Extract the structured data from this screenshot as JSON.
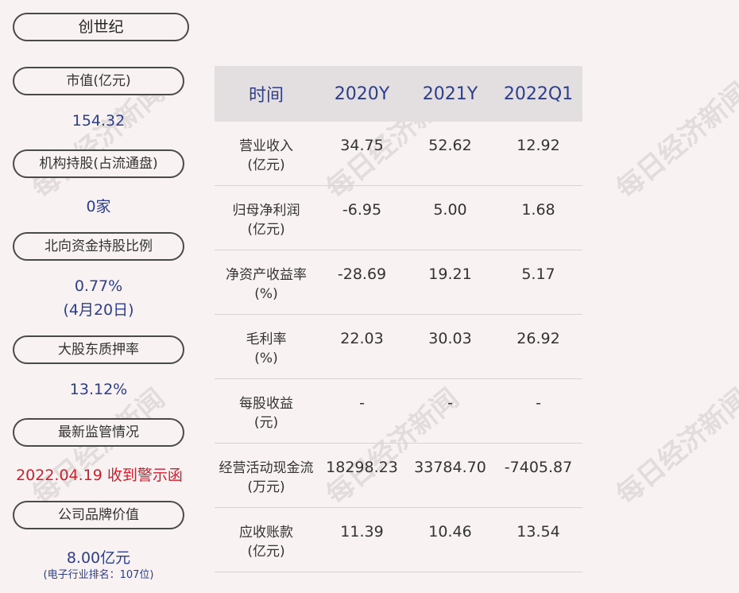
{
  "company": "创世纪",
  "metrics": [
    {
      "label": "市值(亿元)",
      "value": "154.32"
    },
    {
      "label": "机构持股(占流通盘)",
      "value": "0家"
    },
    {
      "label": "北向资金持股比例",
      "value": "0.77%",
      "value2": "(4月20日)"
    },
    {
      "label": "大股东质押率",
      "value": "13.12%"
    },
    {
      "label": "最新监管情况",
      "value": "2022.04.19 收到警示函"
    },
    {
      "label": "公司品牌价值",
      "value": "8.00亿元",
      "note": "(电子行业排名：107位)"
    }
  ],
  "table": {
    "headers": [
      "时间",
      "2020Y",
      "2021Y",
      "2022Q1"
    ],
    "rows": [
      {
        "name": "营业收入",
        "unit": "(亿元)",
        "values": [
          "34.75",
          "52.62",
          "12.92"
        ]
      },
      {
        "name": "归母净利润",
        "unit": "(亿元)",
        "values": [
          "-6.95",
          "5.00",
          "1.68"
        ]
      },
      {
        "name": "净资产收益率",
        "unit": "(%)",
        "values": [
          "-28.69",
          "19.21",
          "5.17"
        ]
      },
      {
        "name": "毛利率",
        "unit": "(%)",
        "values": [
          "22.03",
          "30.03",
          "26.92"
        ]
      },
      {
        "name": "每股收益",
        "unit": "(元)",
        "values": [
          "-",
          "-",
          "-"
        ]
      },
      {
        "name": "经营活动现金流",
        "unit": "(万元)",
        "values": [
          "18298.23",
          "33784.70",
          "-7405.87"
        ]
      },
      {
        "name": "应收账款",
        "unit": "(亿元)",
        "values": [
          "11.39",
          "10.46",
          "13.54"
        ]
      }
    ]
  },
  "watermark": "每日经济新闻",
  "colors": {
    "accent": "#2c3e8c",
    "alert": "#d0202e",
    "background": "#f8f2f2",
    "header_bg": "#e3dfe0"
  }
}
